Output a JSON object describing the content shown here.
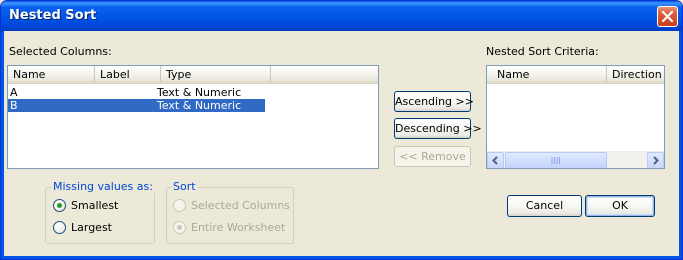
{
  "window": {
    "title": "Nested Sort"
  },
  "selected_columns": {
    "label": "Selected Columns:",
    "headers": [
      "Name",
      "Label",
      "Type"
    ],
    "rows": [
      {
        "name": "A",
        "label": "",
        "type": "Text & Numeric",
        "selected": false
      },
      {
        "name": "B",
        "label": "",
        "type": "Text & Numeric",
        "selected": true
      }
    ]
  },
  "middle_buttons": {
    "ascending": "Ascending >>",
    "descending": "Descending >>",
    "remove": "<< Remove"
  },
  "nested_sort_criteria": {
    "label": "Nested Sort Criteria:",
    "headers": [
      "Name",
      "Direction"
    ]
  },
  "missing_values": {
    "title": "Missing values as:",
    "options": [
      {
        "label": "Smallest",
        "checked": true
      },
      {
        "label": "Largest",
        "checked": false
      }
    ]
  },
  "sort": {
    "title": "Sort",
    "options": [
      {
        "label": "Selected Columns",
        "checked": false,
        "disabled": true
      },
      {
        "label": "Entire Worksheet",
        "checked": true,
        "disabled": true
      }
    ]
  },
  "footer": {
    "cancel": "Cancel",
    "ok": "OK"
  },
  "colors": {
    "titlebar": "#0055e5",
    "selection": "#316ac5",
    "group_title": "#0046d5"
  },
  "icons": {
    "close": "close-icon",
    "scroll_left": "chevron-left-icon",
    "scroll_right": "chevron-right-icon",
    "grip": "grip-icon"
  }
}
